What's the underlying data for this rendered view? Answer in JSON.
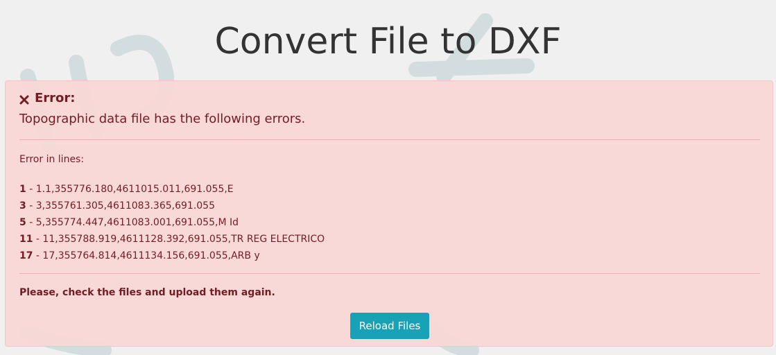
{
  "page": {
    "title": "Convert File to DXF"
  },
  "alert": {
    "icon": "close-icon",
    "heading": "Error:",
    "message": "Topographic data file has the following errors.",
    "lines_label": "Error in lines:",
    "errors": [
      {
        "line": "1",
        "content": " - 1.1,355776.180,4611015.011,691.055,E"
      },
      {
        "line": "3",
        "content": " - 3,355761.305,4611083.365,691.055"
      },
      {
        "line": "5",
        "content": " - 5,355774.447,4611083.001,691.055,M Id"
      },
      {
        "line": "11",
        "content": " - 11,355788.919,4611128.392,691.055,TR REG ELECTRICO"
      },
      {
        "line": "17",
        "content": " - 17,355764.814,4611134.156,691.055,ARB y"
      }
    ],
    "footer_message": "Please, check the files and upload them again.",
    "button_label": "Reload Files"
  },
  "colors": {
    "alert_bg": "#f8d7d5",
    "alert_text": "#721c24",
    "button_bg": "#17a2b8",
    "page_bg": "#f0f0f0"
  }
}
